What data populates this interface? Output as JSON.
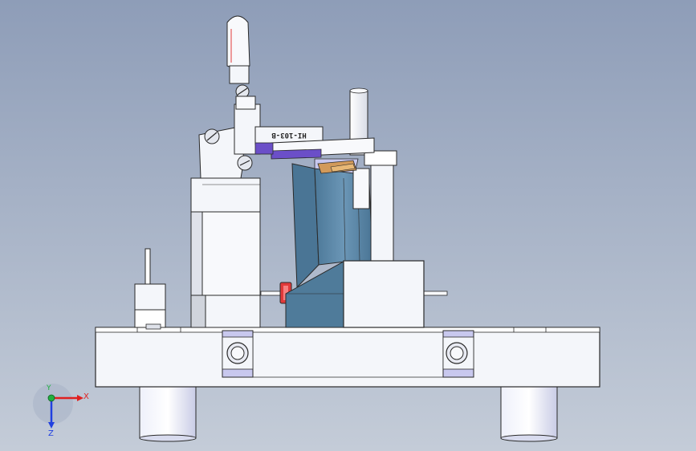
{
  "part_engraving": "HI-103-B",
  "triad": {
    "x_label": "X",
    "y_label": "Y",
    "z_label": "Z"
  },
  "colors": {
    "background_top": "#8e9db8",
    "background_bottom": "#c4ccd8",
    "part_white": "#f4f6fa",
    "part_blue": "#5c88a8",
    "accent_purple": "#6b4fc8",
    "bushing_lavender": "#c8c8ee",
    "red_pin": "#e23a3a",
    "outline": "#2a2a2a",
    "triad_x": "#e02020",
    "triad_y": "#20b040",
    "triad_z": "#2040e0"
  }
}
